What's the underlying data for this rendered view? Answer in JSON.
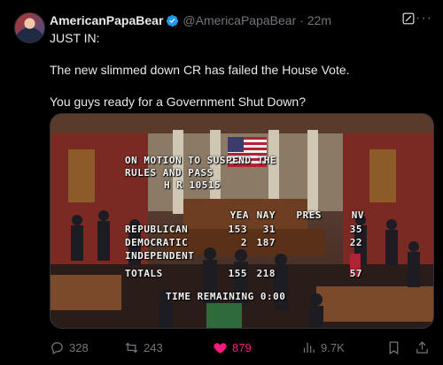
{
  "post": {
    "author_name": "AmericanPapaBear",
    "handle": "@AmericaPapaBear",
    "time": "· 22m",
    "more": "···",
    "paragraphs": [
      "JUST IN:",
      "The new slimmed down CR has failed the House Vote.",
      "You guys ready for a Government Shut Down?"
    ]
  },
  "media": {
    "board": {
      "line1": "ON MOTION TO SUSPEND THE",
      "line2": "RULES AND PASS",
      "bill": "H R   10515",
      "col_headers": [
        "YEA",
        "NAY",
        "PRES",
        "NV"
      ],
      "rows": [
        {
          "party": "REPUBLICAN",
          "yea": "153",
          "nay": "31",
          "pres": "",
          "nv": "35"
        },
        {
          "party": "DEMOCRATIC",
          "yea": "2",
          "nay": "187",
          "pres": "",
          "nv": "22"
        },
        {
          "party": "INDEPENDENT",
          "yea": "",
          "nay": "",
          "pres": "",
          "nv": ""
        },
        {
          "party": "TOTALS",
          "yea": "155",
          "nay": "218",
          "pres": "",
          "nv": "57"
        }
      ],
      "time_remaining": "TIME REMAINING  0:00"
    }
  },
  "actions": {
    "replies": "328",
    "reposts": "243",
    "likes": "879",
    "views": "9.7K"
  },
  "colors": {
    "like": "#f91880",
    "verified": "#1d9bf0",
    "muted": "#71767b"
  }
}
